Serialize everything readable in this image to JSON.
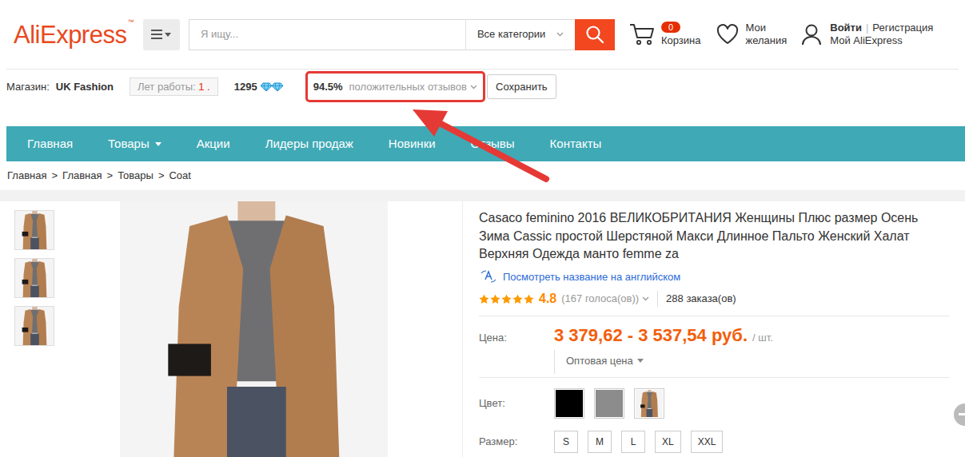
{
  "header": {
    "logo": "AliExpress",
    "logo_mark": "™",
    "search": {
      "placeholder": "Я ищу..."
    },
    "category": "Все категории",
    "cart": {
      "count": "0",
      "label": "Корзина"
    },
    "wishlist": {
      "label_1": "Мои",
      "label_2": "желания"
    },
    "account": {
      "login": "Войти",
      "separator": "|",
      "register": "Регистрация",
      "my": "Мой AliExpress"
    }
  },
  "store": {
    "label": "Магазин:",
    "name": "UK Fashion",
    "years_label": "Лет работы:",
    "years": "1 .",
    "score": "1295",
    "diamonds": 2,
    "feedback": {
      "percent": "94.5%",
      "label": "положительных отзывов",
      "highlighted": true
    },
    "save": "Сохранить"
  },
  "annotation": {
    "arrow": true
  },
  "nav": [
    {
      "label": "Главная",
      "kind": "link"
    },
    {
      "label": "Товары",
      "kind": "menu"
    },
    {
      "label": "Акции",
      "kind": "link"
    },
    {
      "label": "Лидеры продаж",
      "kind": "link"
    },
    {
      "label": "Новинки",
      "kind": "link"
    },
    {
      "label": "Отзывы",
      "kind": "link"
    },
    {
      "label": "Контакты",
      "kind": "link"
    }
  ],
  "breadcrumb": {
    "items": [
      "Главная",
      "Главная",
      "Товары",
      "Coat"
    ],
    "separator": ">"
  },
  "gallery": {
    "thumbs": [
      {
        "kind": "photo"
      },
      {
        "kind": "photo"
      },
      {
        "kind": "photo"
      }
    ]
  },
  "product": {
    "title": "Casaco feminino 2016 ВЕЛИКОБРИТАНИЯ Женщины Плюс размер Осень Зима Cassic простой Шерстяной Макси Длинное Пальто Женский Халат Верхняя Одежда манто femme za",
    "translate": "Посмотреть название на английском",
    "stars": 5,
    "rating": "4.8",
    "votes": "(167 голоса(ов))",
    "orders": "288 заказа(ов)",
    "price_label": "Цена:",
    "price": "3 379,62 - 3 537,54 руб.",
    "unit": "/ шт.",
    "wholesale": "Оптовая цена",
    "color_label": "Цвет:",
    "colors": [
      {
        "kind": "swatch",
        "color": "#000000",
        "selected": false
      },
      {
        "kind": "swatch",
        "color": "#8c8c8c",
        "selected": false
      },
      {
        "kind": "photo",
        "selected": false
      }
    ],
    "size_label": "Размер:",
    "sizes": [
      {
        "label": "S",
        "selected": false
      },
      {
        "label": "M",
        "selected": false
      },
      {
        "label": "L",
        "selected": false
      },
      {
        "label": "XL",
        "selected": false
      },
      {
        "label": "XXL",
        "selected": false
      }
    ]
  }
}
